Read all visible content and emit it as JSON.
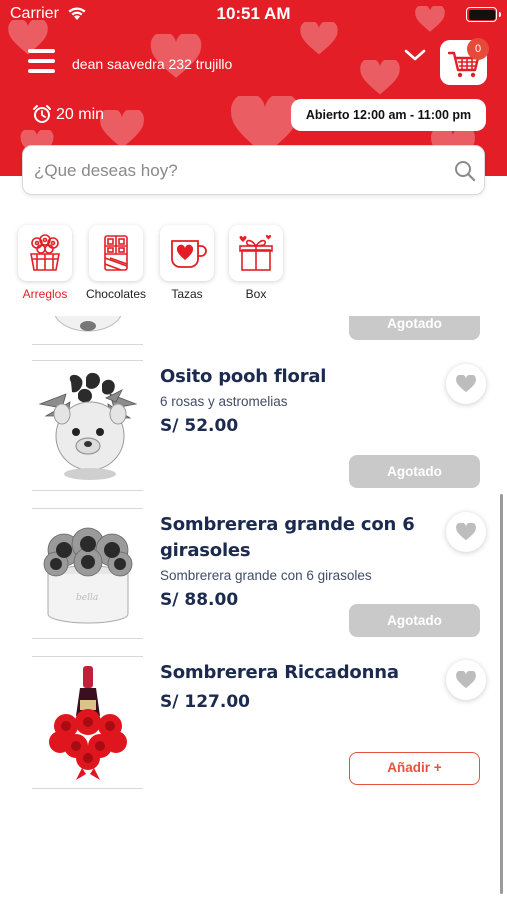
{
  "status_bar": {
    "carrier": "Carrier",
    "time": "10:51 AM"
  },
  "header": {
    "address": "dean saavedra 232 trujillo",
    "cart_count": "0",
    "delivery_time": "20 min",
    "hours": "Abierto 12:00 am - 11:00 pm",
    "brand_color": "#e31e26"
  },
  "search": {
    "placeholder": "¿Que deseas hoy?"
  },
  "categories": [
    {
      "label": "Arreglos",
      "icon": "flower-basket-icon",
      "active": true
    },
    {
      "label": "Chocolates",
      "icon": "chocolate-icon",
      "active": false
    },
    {
      "label": "Tazas",
      "icon": "mug-icon",
      "active": false
    },
    {
      "label": "Box",
      "icon": "gift-box-icon",
      "active": false
    }
  ],
  "products": [
    {
      "name": "",
      "description": "",
      "price": "",
      "status": "Agotado"
    },
    {
      "name": "Osito pooh floral",
      "description": "6 rosas y astromelias",
      "price": "S/ 52.00",
      "status": "Agotado"
    },
    {
      "name": "Sombrerera grande con 6 girasoles",
      "description": "Sombrerera grande con 6 girasoles",
      "price": "S/ 88.00",
      "status": "Agotado"
    },
    {
      "name": "Sombrerera Riccadonna",
      "description": "",
      "price": "S/ 127.00",
      "action": "Añadir +"
    }
  ]
}
